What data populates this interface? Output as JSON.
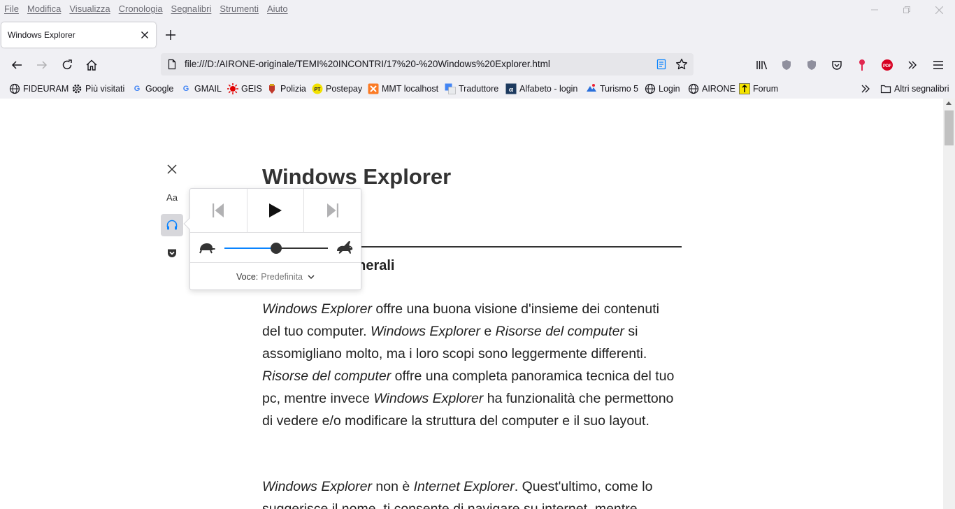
{
  "menu": [
    "File",
    "Modifica",
    "Visualizza",
    "Cronologia",
    "Segnalibri",
    "Strumenti",
    "Aiuto"
  ],
  "tab": {
    "title": "Windows Explorer"
  },
  "url": "file:///D:/AIRONE-originale/TEMI%20INCONTRI/17%20-%20Windows%20Explorer.html",
  "bookmarks": [
    {
      "label": "FIDEURAM",
      "icon": "globe-icon"
    },
    {
      "label": "Più visitati",
      "icon": "gear-icon"
    },
    {
      "label": "Google",
      "icon": "google-icon"
    },
    {
      "label": "GMAIL",
      "icon": "google-icon"
    },
    {
      "label": "GEIS",
      "icon": "sun-icon"
    },
    {
      "label": "Polizia",
      "icon": "crest-icon"
    },
    {
      "label": "Postepay",
      "icon": "pt-icon"
    },
    {
      "label": "MMT localhost",
      "icon": "xampp-icon"
    },
    {
      "label": "Traduttore",
      "icon": "translate-icon"
    },
    {
      "label": "Alfabeto - login",
      "icon": "alpha-icon"
    },
    {
      "label": "Turismo 5",
      "icon": "turismo-icon"
    },
    {
      "label": "Login",
      "icon": "globe-icon"
    },
    {
      "label": "AIRONE",
      "icon": "globe-icon"
    },
    {
      "label": "Forum",
      "icon": "forum-icon"
    }
  ],
  "other_bookmarks": "Altri segnalibri",
  "article": {
    "title": "Windows Explorer",
    "section_heading_visible": "enerali",
    "para1_segments": [
      {
        "t": "Windows Explorer",
        "i": true
      },
      {
        "t": " offre una buona visione d'insieme dei contenuti del tuo computer. ",
        "i": false
      },
      {
        "t": "Windows Explorer",
        "i": true
      },
      {
        "t": " e ",
        "i": false
      },
      {
        "t": "Risorse del computer",
        "i": true
      },
      {
        "t": " si assomigliano molto, ma i loro scopi sono leggermente differenti. ",
        "i": false
      },
      {
        "t": "Risorse del computer",
        "i": true
      },
      {
        "t": " offre una completa panoramica tecnica del tuo pc, mentre invece ",
        "i": false
      },
      {
        "t": "Windows Explorer",
        "i": true
      },
      {
        "t": " ha funzionalità che permettono di vedere e/o modificare la struttura del computer e il suo layout.",
        "i": false
      }
    ],
    "para2_segments": [
      {
        "t": "Windows Explorer",
        "i": true
      },
      {
        "t": " non è ",
        "i": false
      },
      {
        "t": "Internet Explorer",
        "i": true
      },
      {
        "t": ". Quest'ultimo, come lo suggerisce il nome, ti consente di navigare su internet, mentre",
        "i": false
      }
    ]
  },
  "reader": {
    "typography_label": "Aa",
    "voice_label": "Voce:",
    "voice_value": "Predefinita",
    "speed_fraction": 0.5
  },
  "colors": {
    "accent": "#0a84ff",
    "narrate_active_bg": "#d7d7db"
  }
}
